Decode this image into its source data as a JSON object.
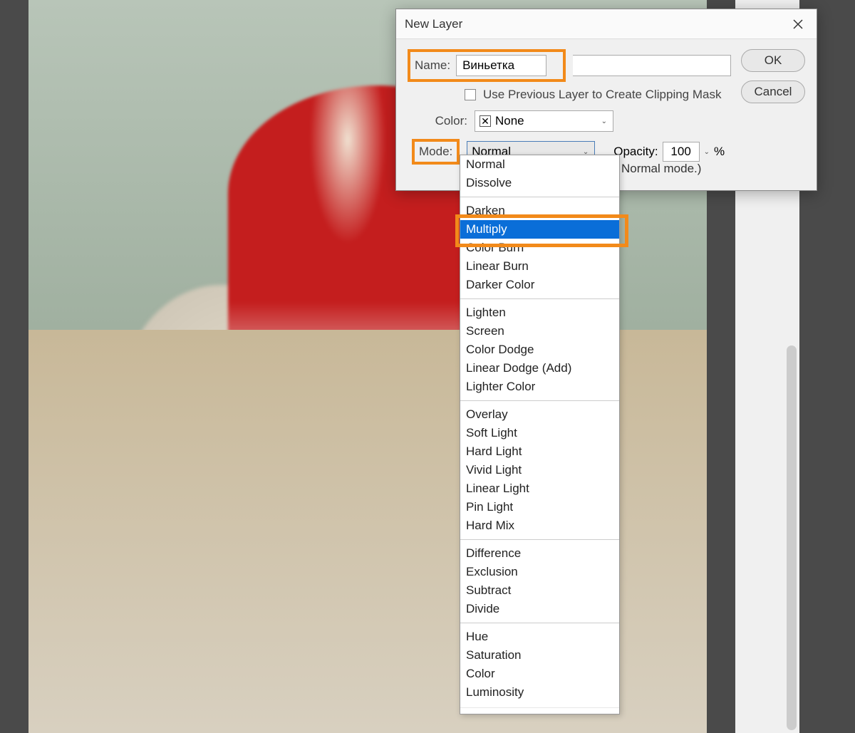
{
  "dialog": {
    "title": "New Layer",
    "name_label": "Name:",
    "name_value": "Виньетка",
    "clipping_mask": "Use Previous Layer to Create Clipping Mask",
    "color_label": "Color:",
    "color_value": "None",
    "mode_label": "Mode:",
    "mode_value": "Normal",
    "opacity_label": "Opacity:",
    "opacity_value": "100",
    "opacity_unit": "%",
    "hint_suffix": "Normal mode.)",
    "ok_button": "OK",
    "cancel_button": "Cancel"
  },
  "blend_modes": {
    "group1": [
      "Normal",
      "Dissolve"
    ],
    "group2": [
      "Darken",
      "Multiply",
      "Color Burn",
      "Linear Burn",
      "Darker Color"
    ],
    "group3": [
      "Lighten",
      "Screen",
      "Color Dodge",
      "Linear Dodge (Add)",
      "Lighter Color"
    ],
    "group4": [
      "Overlay",
      "Soft Light",
      "Hard Light",
      "Vivid Light",
      "Linear Light",
      "Pin Light",
      "Hard Mix"
    ],
    "group5": [
      "Difference",
      "Exclusion",
      "Subtract",
      "Divide"
    ],
    "group6": [
      "Hue",
      "Saturation",
      "Color",
      "Luminosity"
    ],
    "highlighted": "Multiply"
  }
}
